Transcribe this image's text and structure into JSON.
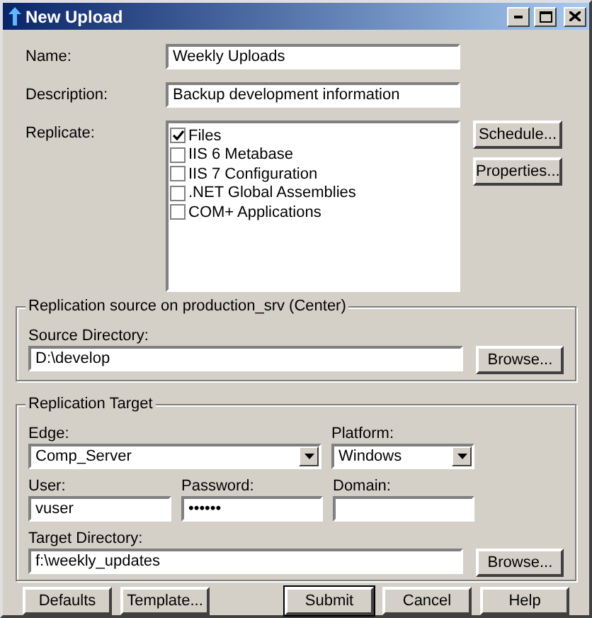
{
  "window": {
    "title": "New Upload"
  },
  "name": {
    "label": "Name:",
    "value": "Weekly Uploads"
  },
  "description": {
    "label": "Description:",
    "value": "Backup development information"
  },
  "replicate": {
    "label": "Replicate:",
    "items": [
      {
        "label": "Files",
        "checked": true
      },
      {
        "label": "IIS 6 Metabase",
        "checked": false
      },
      {
        "label": "IIS 7 Configuration",
        "checked": false
      },
      {
        "label": ".NET Global Assemblies",
        "checked": false
      },
      {
        "label": "COM+ Applications",
        "checked": false
      }
    ]
  },
  "side_buttons": [
    "Schedule...",
    "Properties..."
  ],
  "source": {
    "legend": "Replication source on production_srv (Center)",
    "label": "Source Directory:",
    "value": "D:\\develop",
    "button": "Browse..."
  },
  "target": {
    "legend": "Replication Target",
    "edge": {
      "label": "Edge:",
      "value": "Comp_Server"
    },
    "platform": {
      "label": "Platform:",
      "value": "Windows"
    },
    "user": {
      "label": "User:",
      "value": "vuser"
    },
    "password": {
      "label": "Password:",
      "value": "••••••"
    },
    "domain": {
      "label": "Domain:"
    },
    "directory": {
      "label": "Target Directory:",
      "value": "f:\\weekly_updates"
    },
    "button": "Browse..."
  },
  "buttons": [
    {
      "label": "Defaults",
      "default": false
    },
    {
      "label": "Template...",
      "default": false
    },
    {
      "label": "Submit",
      "default": true
    },
    {
      "label": "Cancel",
      "default": false
    },
    {
      "label": "Help",
      "default": false
    }
  ]
}
